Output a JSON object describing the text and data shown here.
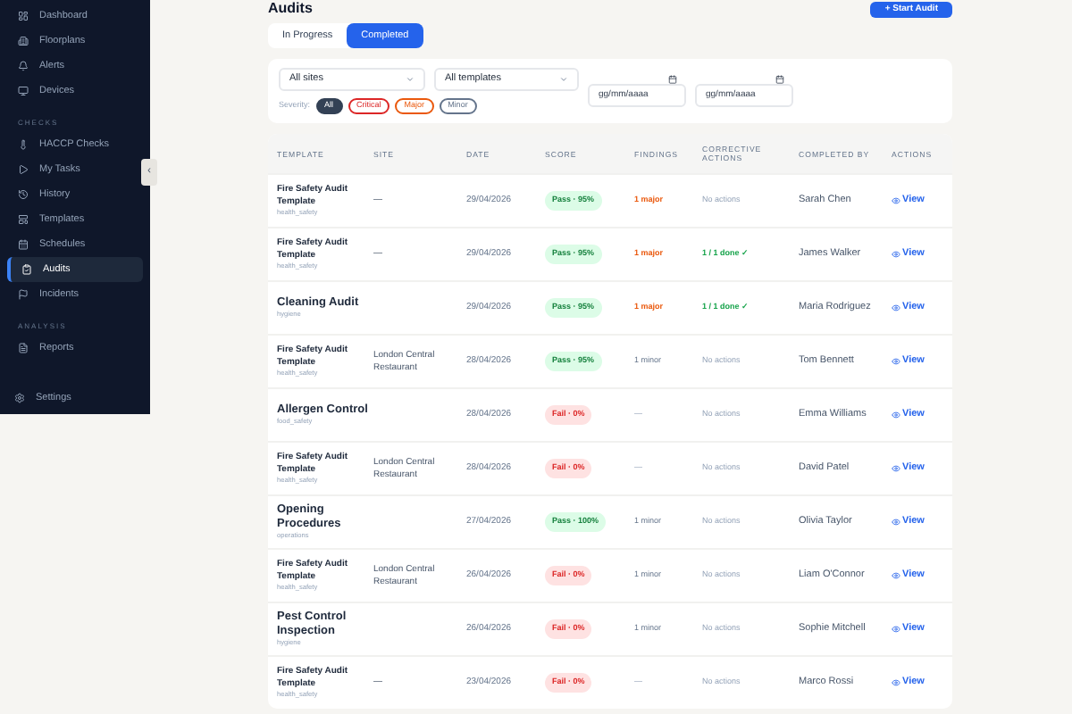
{
  "sidebar": {
    "groups": [
      {
        "items": [
          {
            "label": "Dashboard",
            "selected": false
          },
          {
            "label": "Floorplans",
            "selected": false
          },
          {
            "label": "Alerts",
            "selected": false
          },
          {
            "label": "Devices",
            "selected": false
          }
        ]
      },
      {
        "title": "CHECKS",
        "items": [
          {
            "label": "HACCP Checks",
            "selected": false
          },
          {
            "label": "My Tasks",
            "selected": false
          },
          {
            "label": "History",
            "selected": false
          },
          {
            "label": "Templates",
            "selected": false
          },
          {
            "label": "Schedules",
            "selected": false
          },
          {
            "label": "Audits",
            "selected": true
          },
          {
            "label": "Incidents",
            "selected": false
          }
        ]
      },
      {
        "title": "ANALYSIS",
        "items": [
          {
            "label": "Reports",
            "selected": false
          }
        ]
      }
    ],
    "footer": {
      "label": "Settings"
    },
    "collapse_button": "‹"
  },
  "header": {
    "title": "Audits",
    "button": "+ Start Audit"
  },
  "tabs": [
    {
      "label": "In Progress",
      "selected": false
    },
    {
      "label": "Completed",
      "selected": true
    }
  ],
  "filters": {
    "site": "All sites",
    "template": "All templates",
    "date_from": {
      "placeholder": "gg/mm/aaaa"
    },
    "date_to": {
      "placeholder": "gg/mm/aaaa"
    },
    "severity_label": "Severity:",
    "severity": [
      {
        "label": "All",
        "selected": true,
        "color": "#334155"
      },
      {
        "label": "Critical",
        "selected": false,
        "color": "#dc2626"
      },
      {
        "label": "Major",
        "selected": false,
        "color": "#ea580c"
      },
      {
        "label": "Minor",
        "selected": false,
        "color": "#64748b"
      }
    ]
  },
  "table": {
    "columns": [
      "TEMPLATE",
      "SITE",
      "DATE",
      "SCORE",
      "FINDINGS",
      "CORRECTIVE ACTIONS",
      "COMPLETED BY",
      "ACTIONS"
    ],
    "rows": [
      {
        "kind": "standard",
        "template": "Fire Safety Audit Template",
        "category": "health_safety",
        "site": "—",
        "date": "29/04/2026",
        "score": {
          "kind": "pass",
          "text": "Pass · 95%"
        },
        "findings": {
          "kind": "major",
          "text": "1 major"
        },
        "actions": {
          "kind": "none",
          "text": "No actions"
        },
        "completed_by": "Sarah Chen",
        "action": "View"
      },
      {
        "kind": "standard",
        "template": "Fire Safety Audit Template",
        "category": "health_safety",
        "site": "—",
        "date": "29/04/2026",
        "score": {
          "kind": "pass",
          "text": "Pass · 95%"
        },
        "findings": {
          "kind": "major",
          "text": "1 major"
        },
        "actions": {
          "kind": "done",
          "text": "1 / 1 done ✓"
        },
        "completed_by": "James Walker",
        "action": "View"
      },
      {
        "kind": "custom",
        "template": "Cleaning Audit",
        "category": "hygiene",
        "site": "",
        "date": "29/04/2026",
        "score": {
          "kind": "pass",
          "text": "Pass · 95%"
        },
        "findings": {
          "kind": "major",
          "text": "1 major"
        },
        "actions": {
          "kind": "done",
          "text": "1 / 1 done ✓"
        },
        "completed_by": "Maria Rodriguez",
        "action": "View"
      },
      {
        "kind": "standard",
        "template": "Fire Safety Audit Template",
        "category": "health_safety",
        "site": "London Central Restaurant",
        "date": "28/04/2026",
        "score": {
          "kind": "pass",
          "text": "Pass · 95%"
        },
        "findings": {
          "kind": "minor",
          "text": "1 minor"
        },
        "actions": {
          "kind": "none",
          "text": "No actions"
        },
        "completed_by": "Tom Bennett",
        "action": "View"
      },
      {
        "kind": "custom",
        "template": "Allergen Control",
        "category": "food_safety",
        "site": "",
        "date": "28/04/2026",
        "score": {
          "kind": "fail",
          "text": "Fail · 0%"
        },
        "findings": {
          "kind": "none",
          "text": "—"
        },
        "actions": {
          "kind": "none",
          "text": "No actions"
        },
        "completed_by": "Emma Williams",
        "action": "View"
      },
      {
        "kind": "standard",
        "template": "Fire Safety Audit Template",
        "category": "health_safety",
        "site": "London Central Restaurant",
        "date": "28/04/2026",
        "score": {
          "kind": "fail",
          "text": "Fail · 0%"
        },
        "findings": {
          "kind": "none",
          "text": "—"
        },
        "actions": {
          "kind": "none",
          "text": "No actions"
        },
        "completed_by": "David Patel",
        "action": "View"
      },
      {
        "kind": "custom",
        "template": "Opening Procedures",
        "category": "operations",
        "site": "",
        "date": "27/04/2026",
        "score": {
          "kind": "pass",
          "text": "Pass · 100%"
        },
        "findings": {
          "kind": "minor",
          "text": "1 minor"
        },
        "actions": {
          "kind": "none",
          "text": "No actions"
        },
        "completed_by": "Olivia Taylor",
        "action": "View"
      },
      {
        "kind": "standard",
        "template": "Fire Safety Audit Template",
        "category": "health_safety",
        "site": "London Central Restaurant",
        "date": "26/04/2026",
        "score": {
          "kind": "fail",
          "text": "Fail · 0%"
        },
        "findings": {
          "kind": "minor",
          "text": "1 minor"
        },
        "actions": {
          "kind": "none",
          "text": "No actions"
        },
        "completed_by": "Liam O'Connor",
        "action": "View"
      },
      {
        "kind": "custom",
        "template": "Pest Control Inspection",
        "category": "hygiene",
        "site": "",
        "date": "26/04/2026",
        "score": {
          "kind": "fail",
          "text": "Fail · 0%"
        },
        "findings": {
          "kind": "minor",
          "text": "1 minor"
        },
        "actions": {
          "kind": "none",
          "text": "No actions"
        },
        "completed_by": "Sophie Mitchell",
        "action": "View"
      },
      {
        "kind": "standard",
        "template": "Fire Safety Audit Template",
        "category": "health_safety",
        "site": "—",
        "date": "23/04/2026",
        "score": {
          "kind": "fail",
          "text": "Fail · 0%"
        },
        "findings": {
          "kind": "none",
          "text": "—"
        },
        "actions": {
          "kind": "none",
          "text": "No actions"
        },
        "completed_by": "Marco Rossi",
        "action": "View"
      }
    ]
  }
}
